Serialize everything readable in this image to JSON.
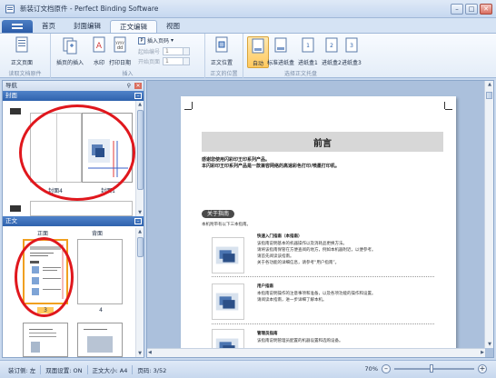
{
  "window": {
    "title": "新装订文档原件 - Perfect Binding Software"
  },
  "tabs": [
    "首页",
    "封面编辑",
    "正文编辑",
    "视图"
  ],
  "active_tab": "正文编辑",
  "ribbon": {
    "groups": {
      "read": "读取文档原件",
      "insert": "插入",
      "position": "正文的位置",
      "tray": "选择正文托盘"
    },
    "buttons": {
      "read_body": "正文页面",
      "insert_blank": "插页的插入",
      "watermark": "水印",
      "print_date": "打印日期",
      "insert_page_no": "插入页码",
      "start_no": "起始编号",
      "start_page": "开始页面",
      "position": "正文位置",
      "auto": "自动",
      "std_tray": "标准进纸盒",
      "tray1": "进纸盒1",
      "tray2": "进纸盒2",
      "tray3": "进纸盒3"
    },
    "spin_values": {
      "start_no": "1",
      "start_page": "1"
    }
  },
  "nav": {
    "title": "导航",
    "pin": "⚲",
    "cover_section": "封面",
    "body_section": "正文",
    "cover_labels": {
      "cover4": "封面4",
      "cover1": "封面1"
    },
    "body_headers": {
      "front": "正面",
      "back": "背面"
    },
    "page_numbers": [
      "3",
      "4"
    ]
  },
  "doc": {
    "preface_title": "前言",
    "intro_line1": "感谢您使用闪彩印王印系列产品。",
    "intro_line2": "本闪彩印王印系列产品是一款兼容网络的高速彩色打印/喷墨打印机。",
    "guide_pill": "关于指南",
    "guide_desc": "本机附带有以下三本指南。",
    "sections": [
      {
        "title": "快速入门指南（本指南）",
        "lines": [
          "该指南说明基本的机器操作以及消耗品更换方法。",
          "请将该指南保管在方便查阅的地方，例如本机器附近，以便参考。",
          "请首先阅读该指南。",
          "关于各功能的详细信息，请参考“用户指南”。"
        ]
      },
      {
        "title": "用户指南",
        "lines": [
          "本指南说明操作的注意事项和准备，以及各项功能的操作和设置。",
          "请阅读本指南，进一步详细了解本机。"
        ]
      },
      {
        "title": "管理员指南",
        "lines": [
          "该指南说明管理员配置的机器设置和选购设备。"
        ]
      }
    ]
  },
  "status": {
    "binding": "装订侧: 左",
    "duplex": "双面设置: ON",
    "size": "正文大小: A4",
    "page": "页码: 3/52",
    "zoom": "70%"
  },
  "colors": {
    "accent": "#2e62ad",
    "highlight": "#e0171d",
    "selected": "#ffc95e"
  }
}
